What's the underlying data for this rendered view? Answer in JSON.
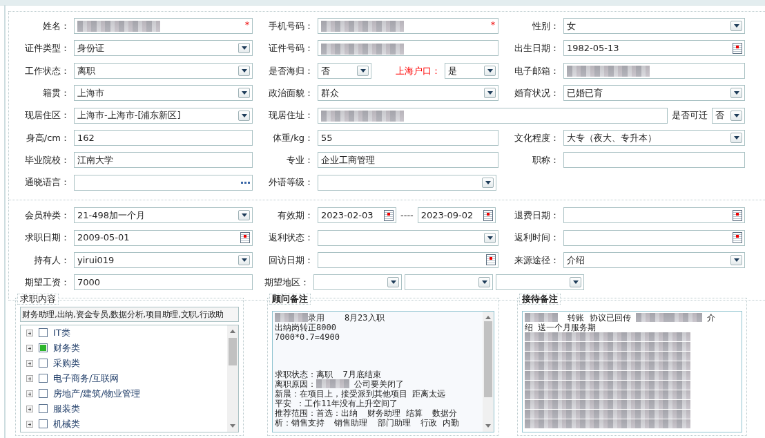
{
  "personal": [
    {
      "groups": [
        {
          "label": "姓名：",
          "control": {
            "kind": "text",
            "redacted": true,
            "required_mark": "*"
          }
        },
        {
          "label": "手机号码：",
          "control": {
            "kind": "text",
            "redacted": true,
            "required_mark": "*"
          }
        },
        {
          "label": "性别：",
          "control": {
            "kind": "select",
            "value": "女"
          }
        }
      ]
    },
    {
      "groups": [
        {
          "label": "证件类型：",
          "control": {
            "kind": "select",
            "value": "身份证"
          }
        },
        {
          "label": "证件号码：",
          "control": {
            "kind": "text",
            "redacted": true
          }
        },
        {
          "label": "出生日期：",
          "control": {
            "kind": "date",
            "value": "1982-05-13"
          }
        }
      ]
    },
    {
      "groups": [
        {
          "label": "工作状态：",
          "control": {
            "kind": "select",
            "value": "离职"
          }
        },
        {
          "label": "是否海归：",
          "control": {
            "kind": "select",
            "value": "否"
          },
          "extra": {
            "label": "上海户口：",
            "highlighted": true,
            "control": {
              "kind": "select",
              "value": "是"
            }
          }
        },
        {
          "label": "电子邮箱：",
          "control": {
            "kind": "text",
            "redacted": true
          }
        }
      ]
    },
    {
      "groups": [
        {
          "label": "籍贯：",
          "control": {
            "kind": "select",
            "value": "上海市"
          }
        },
        {
          "label": "政治面貌：",
          "control": {
            "kind": "select",
            "value": "群众"
          }
        },
        {
          "label": "婚育状况：",
          "control": {
            "kind": "select",
            "value": "已婚已育"
          }
        }
      ]
    },
    {
      "groups": [
        {
          "label": "现居住区：",
          "control": {
            "kind": "select",
            "value": "上海市-上海市-[浦东新区]"
          }
        },
        {
          "label": "现居住址：",
          "control": {
            "kind": "text",
            "redacted": true
          },
          "extra": {
            "label": "是否可迁",
            "highlighted": false,
            "control": {
              "kind": "select",
              "value": "否"
            }
          }
        }
      ]
    },
    {
      "groups": [
        {
          "label": "身高/cm：",
          "control": {
            "kind": "text",
            "value": "162"
          }
        },
        {
          "label": "体重/kg：",
          "control": {
            "kind": "text",
            "value": "55"
          }
        },
        {
          "label": "文化程度：",
          "control": {
            "kind": "select",
            "value": "大专（夜大、专升本）"
          }
        }
      ]
    },
    {
      "groups": [
        {
          "label": "毕业院校：",
          "control": {
            "kind": "text",
            "value": "江南大学"
          }
        },
        {
          "label": "专业：",
          "control": {
            "kind": "text",
            "value": "企业工商管理"
          }
        },
        {
          "label": "职称：",
          "control": {
            "kind": "text"
          }
        }
      ]
    },
    {
      "groups": [
        {
          "label": "通晓语言：",
          "control": {
            "kind": "picker"
          }
        },
        {
          "label": "外语等级：",
          "control": {
            "kind": "select"
          }
        }
      ]
    }
  ],
  "membership": [
    {
      "groups": [
        {
          "label": "会员种类：",
          "control": {
            "kind": "select",
            "value": "21-498加一个月"
          }
        },
        {
          "label": "有效期：",
          "control": {
            "kind": "date_range",
            "from": "2023-02-03",
            "separator": "----",
            "to": "2023-09-02"
          }
        },
        {
          "label": "退费日期：",
          "control": {
            "kind": "date"
          }
        }
      ]
    },
    {
      "groups": [
        {
          "label": "求职日期：",
          "control": {
            "kind": "date",
            "value": "2009-05-01"
          }
        },
        {
          "label": "返利状态：",
          "control": {
            "kind": "select"
          }
        },
        {
          "label": "返利时间：",
          "control": {
            "kind": "date"
          }
        }
      ]
    },
    {
      "groups": [
        {
          "label": "持有人：",
          "control": {
            "kind": "select",
            "value": "yirui019"
          }
        },
        {
          "label": "回访日期：",
          "control": {
            "kind": "date"
          }
        },
        {
          "label": "来源途径：",
          "control": {
            "kind": "select",
            "value": "介绍"
          }
        }
      ]
    },
    {
      "groups": [
        {
          "label": "期望工资：",
          "control": {
            "kind": "text",
            "value": "7000"
          }
        },
        {
          "label": "期望地区：",
          "control": {
            "kind": "select_group",
            "controls": [
              {
                "kind": "select"
              },
              {
                "kind": "select"
              },
              {
                "kind": "select"
              }
            ]
          }
        }
      ]
    }
  ],
  "job_content": {
    "title": "求职内容",
    "summary": "财务助理,出纳,资金专员,数据分析,项目助理,文职,行政助",
    "tree": [
      {
        "label": "IT类",
        "checked": false,
        "expanded": false
      },
      {
        "label": "财务类",
        "checked": true,
        "expanded": false
      },
      {
        "label": "采购类",
        "checked": false,
        "expanded": false
      },
      {
        "label": "电子商务/互联网",
        "checked": false,
        "expanded": false
      },
      {
        "label": "房地产/建筑/物业管理",
        "checked": false,
        "expanded": false
      },
      {
        "label": "服装类",
        "checked": false,
        "expanded": false
      },
      {
        "label": "机械类",
        "checked": false,
        "expanded": false
      }
    ]
  },
  "advisor_notes": {
    "title": "顾问备注",
    "paragraphs": [
      [
        [
          {
            "kind": "redacted"
          },
          {
            "kind": "text",
            "text": "录用    8月23入职"
          }
        ],
        [
          {
            "kind": "text",
            "text": "出纳岗转正8000"
          }
        ],
        [
          {
            "kind": "text",
            "text": "7000*0.7=4900"
          }
        ]
      ],
      [
        [
          {
            "kind": "text",
            "text": "求职状态：离职  7月底结束"
          }
        ],
        [
          {
            "kind": "text",
            "text": "离职原因："
          },
          {
            "kind": "redacted"
          },
          {
            "kind": "text",
            "text": " 公司要关闭了"
          }
        ],
        [
          {
            "kind": "text",
            "text": "新晨：在项目上，接受派到其他项目 距离太远"
          }
        ],
        [
          {
            "kind": "text",
            "text": "平安 ：工作11年没有上升空间了"
          }
        ],
        [
          {
            "kind": "text",
            "text": "推荐范围：首选：出纳  财务助理 结算  数据分"
          }
        ],
        [
          {
            "kind": "text",
            "text": "析：销售支持  销售助理  部门助理  行政 内勤"
          }
        ]
      ]
    ]
  },
  "reception_notes": {
    "title": "接待备注",
    "paragraphs": [
      [
        [
          {
            "kind": "redacted"
          },
          {
            "kind": "text",
            "text": "  转账 协议已回传 "
          },
          {
            "kind": "redacted"
          },
          {
            "kind": "redacted"
          },
          {
            "kind": "text",
            "text": " 介"
          }
        ],
        [
          {
            "kind": "text",
            "text": "绍 送一个月服务期"
          }
        ],
        [
          {
            "kind": "redacted_line"
          }
        ],
        [
          {
            "kind": "redacted_line"
          }
        ],
        [
          {
            "kind": "redacted_line"
          }
        ],
        [
          {
            "kind": "redacted_line"
          }
        ],
        [
          {
            "kind": "redacted_line"
          }
        ],
        [
          {
            "kind": "redacted_line"
          }
        ],
        [
          {
            "kind": "redacted_line"
          }
        ],
        [
          {
            "kind": "redacted_line"
          }
        ],
        [
          {
            "kind": "redacted_line"
          }
        ],
        [
          {
            "kind": "redacted_line"
          }
        ]
      ]
    ]
  }
}
